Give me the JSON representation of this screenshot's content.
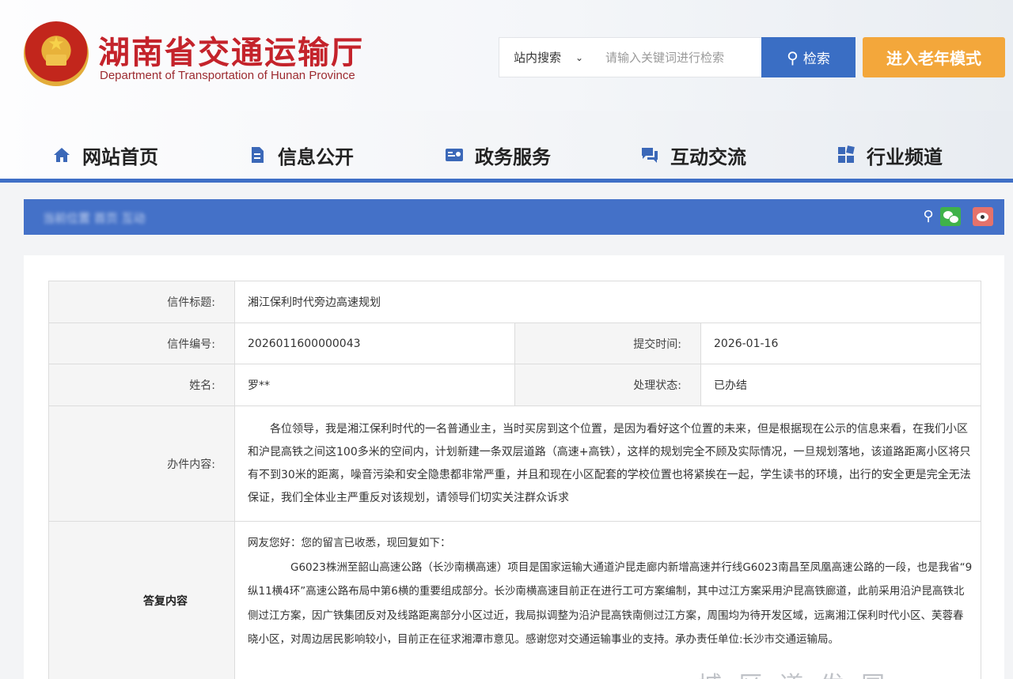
{
  "header": {
    "title": "湖南省交通运输厅",
    "subtitle": "Department of Transportation of Hunan Province",
    "search": {
      "scope": "站内搜索",
      "placeholder": "请输入关键词进行检索",
      "button": "检索"
    },
    "elder_mode": "进入老年模式"
  },
  "nav": {
    "items": [
      {
        "label": "网站首页",
        "icon": "home-icon"
      },
      {
        "label": "信息公开",
        "icon": "document-icon"
      },
      {
        "label": "政务服务",
        "icon": "id-card-icon"
      },
      {
        "label": "互动交流",
        "icon": "chat-icon"
      },
      {
        "label": "行业频道",
        "icon": "grid-icon"
      }
    ]
  },
  "banner": {
    "text": "当前位置 首页 互动",
    "icons": [
      "share-icon",
      "wechat-icon",
      "weibo-icon"
    ]
  },
  "letter": {
    "title_label": "信件标题:",
    "title": "湘江保利时代旁边高速规划",
    "number_label": "信件编号:",
    "number": "2026011600000043",
    "submit_label": "提交时间:",
    "submit_time": "2026-01-16",
    "name_label": "姓名:",
    "name": "罗**",
    "status_label": "处理状态:",
    "status": "已办结",
    "content_label": "办件内容:",
    "content": "各位领导，我是湘江保利时代的一名普通业主，当时买房到这个位置，是因为看好这个位置的未来，但是根据现在公示的信息来看，在我们小区和沪昆高铁之间这100多米的空间内，计划新建一条双层道路（高速+高铁），这样的规划完全不顾及实际情况，一旦规划落地，该道路距离小区将只有不到30米的距离，噪音污染和安全隐患都非常严重，并且和现在小区配套的学校位置也将紧挨在一起，学生读书的环境，出行的安全更是完全无法保证，我们全体业主严重反对该规划，请领导们切实关注群众诉求",
    "reply_label": "答复内容",
    "reply_greeting": "网友您好：您的留言已收悉，现回复如下：",
    "reply_body": "G6023株洲至韶山高速公路（长沙南横高速）项目是国家运输大通道沪昆走廊内新增高速并行线G6023南昌至凤凰高速公路的一段，也是我省“9纵11横4环”高速公路布局中第6横的重要组成部分。长沙南横高速目前正在进行工可方案编制，其中过江方案采用沪昆高铁廊道，此前采用沿沪昆高铁北侧过江方案，因广铁集团反对及线路距离部分小区过近，我局拟调整为沿沪昆高铁南侧过江方案，周围均为待开发区域，远离湘江保利时代小区、芙蓉春晓小区，对周边居民影响较小，目前正在征求湘潭市意见。感谢您对交通运输事业的支持。承办责任单位:长沙市交通运输局。"
  },
  "watermark": "城 区 道 发 国"
}
